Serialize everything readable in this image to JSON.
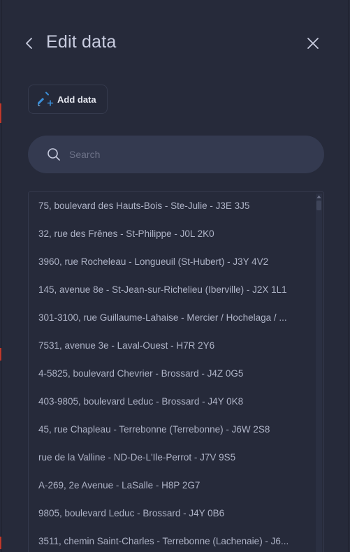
{
  "header": {
    "title": "Edit data"
  },
  "toolbar": {
    "add_label": "Add data"
  },
  "search": {
    "placeholder": "Search",
    "value": ""
  },
  "colors": {
    "background": "#262a3a",
    "search_bg": "#343a50",
    "text": "#aeb3c6",
    "title": "#c9cde0",
    "icon_accent": "#3b8fd9"
  },
  "list": {
    "items": [
      "75, boulevard des Hauts-Bois - Ste-Julie - J3E 3J5",
      "32, rue des Frênes - St-Philippe - J0L 2K0",
      "3960, rue Rocheleau - Longueuil (St-Hubert) - J3Y 4V2",
      "145, avenue 8e - St-Jean-sur-Richelieu (Iberville) - J2X 1L1",
      "301-3100, rue Guillaume-Lahaise - Mercier / Hochelaga / ...",
      "7531, avenue 3e - Laval-Ouest - H7R 2Y6",
      "4-5825, boulevard Chevrier - Brossard - J4Z 0G5",
      "403-9805, boulevard Leduc - Brossard - J4Y 0K8",
      "45, rue Chapleau - Terrebonne (Terrebonne) - J6W 2S8",
      "rue de la Valline - ND-De-L'Ile-Perrot - J7V 9S5",
      "A-269, 2e Avenue - LaSalle - H8P 2G7",
      "9805, boulevard Leduc - Brossard - J4Y 0B6",
      "3511, chemin Saint-Charles - Terrebonne (Lachenaie) - J6..."
    ]
  }
}
